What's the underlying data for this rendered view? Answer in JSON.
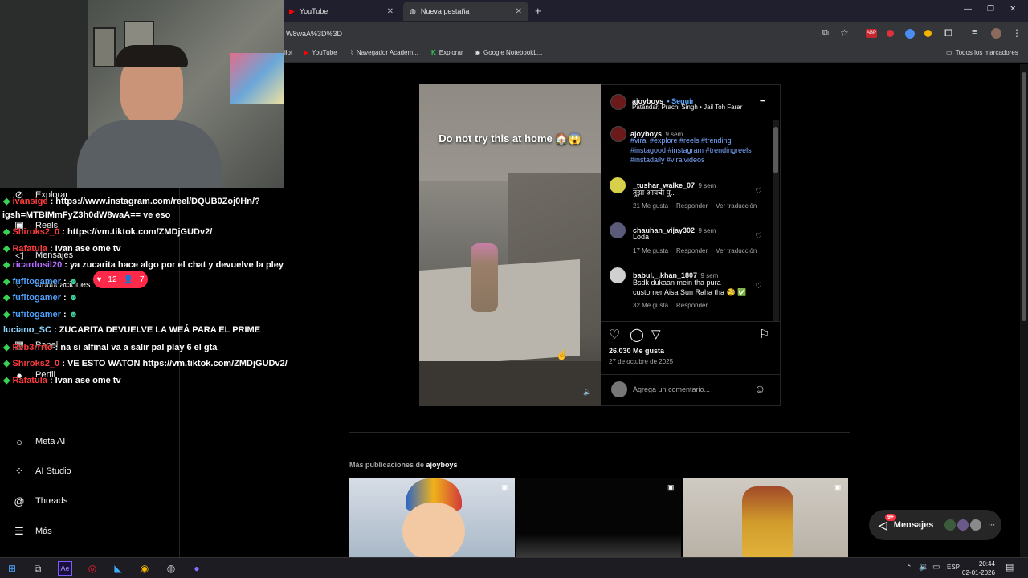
{
  "browser": {
    "tabs": [
      {
        "title": "YouTube"
      },
      {
        "title": "Nueva pestaña"
      }
    ],
    "new_tab": "+",
    "url": "W8waA%3D%3D",
    "bookmarks": [
      {
        "label": "ilot"
      },
      {
        "label": "YouTube"
      },
      {
        "label": "Navegador Académ..."
      },
      {
        "label": "Explorar"
      },
      {
        "label": "Google NotebookL..."
      }
    ],
    "all_bookmarks": "Todos los marcadores"
  },
  "leftnav": {
    "items_top": [
      {
        "label": "Explorar",
        "icon": "compass-icon"
      },
      {
        "label": "Reels",
        "icon": "reels-icon"
      },
      {
        "label": "Mensajes",
        "icon": "messages-icon"
      },
      {
        "label": "Notificaciones",
        "icon": "heart-icon"
      },
      {
        "label": "Panel",
        "icon": "panel-icon"
      },
      {
        "label": "Perfil",
        "icon": "profile-icon"
      }
    ],
    "items_bottom": [
      {
        "label": "Meta AI",
        "icon": "meta-ai-icon"
      },
      {
        "label": "AI Studio",
        "icon": "ai-studio-icon"
      },
      {
        "label": "Threads",
        "icon": "threads-icon"
      },
      {
        "label": "Más",
        "icon": "menu-icon"
      }
    ]
  },
  "chat": {
    "lines": [
      {
        "user": "ivansige",
        "text": ": https://www.instagram.com/reel/DQUB0Zoj0Hn/?"
      },
      {
        "user": "",
        "text": "igsh=MTBIMmFyZ3h0dW8waA== ve eso"
      },
      {
        "user": "Shiroks2_0",
        "text": ": https://vm.tiktok.com/ZMDjGUDv2/"
      },
      {
        "user": "Rafatula",
        "text": ": Ivan ase ome tv"
      },
      {
        "user": "ricardosil20",
        "text": ": ya zucarita hace algo por el chat y devuelve la pley"
      },
      {
        "user": "fufitogamer",
        "text": ":"
      },
      {
        "user": "fufitogamer",
        "text": ":"
      },
      {
        "user": "fufitogamer",
        "text": ":"
      },
      {
        "user": "luciano_SC",
        "text": ": ZUCARITA DEVUELVE LA WEÁ PARA EL PRIME"
      },
      {
        "user": "Rvb3rrrto",
        "text": ": na si alfinal va a salir pal play 6 el gta"
      },
      {
        "user": "Shiroks2_0",
        "text": ": VE ESTO WATON https://vm.tiktok.com/ZMDjGUDv2/"
      },
      {
        "user": "Rafatula",
        "text": ": Ivan ase ome tv"
      }
    ],
    "notif_likes": "12",
    "notif_follows": "7"
  },
  "post": {
    "video_text": "Do not try this at home 🏠😱",
    "author": "ajoyboys",
    "follow": "• Seguir",
    "audio": "Patandar, Prachi Singh • Jail Toh Farar",
    "more": "•••",
    "caption_user": "ajoyboys",
    "caption_time": "9 sem",
    "caption_tags": "#viral #explore #reels #trending #instagood #instagram #trendingreels #instadaily #viralvideos",
    "comments": [
      {
        "user": "_tushar_walke_07",
        "time": "9 sem",
        "text": "तुझा आयची पु..",
        "likes": "21 Me gusta",
        "reply": "Responder",
        "translate": "Ver traducción"
      },
      {
        "user": "chauhan_vijay302",
        "time": "9 sem",
        "text": "Loda",
        "likes": "17 Me gusta",
        "reply": "Responder",
        "translate": "Ver traducción"
      },
      {
        "user": "babul._.khan_1807",
        "time": "9 sem",
        "text": "Bsdk dukaan mein tha pura customer Aisa Sun Raha tha 🧐 ✅",
        "likes": "32 Me gusta",
        "reply": "Responder",
        "translate": ""
      }
    ],
    "like_count": "26.030 Me gusta",
    "date": "27 de octubre de 2025",
    "comment_placeholder": "Agrega un comentario..."
  },
  "more_posts": {
    "label": "Más publicaciones de",
    "author": "ajoyboys"
  },
  "messages_pill": {
    "label": "Mensajes",
    "badge": "9+"
  },
  "taskbar": {
    "lang": "ESP",
    "time": "20:44",
    "date": "02-01-2026"
  },
  "colors": {
    "accent": "#0095f6",
    "hashtag": "#7aa8ff",
    "like_pill": "#ff2a4a"
  }
}
